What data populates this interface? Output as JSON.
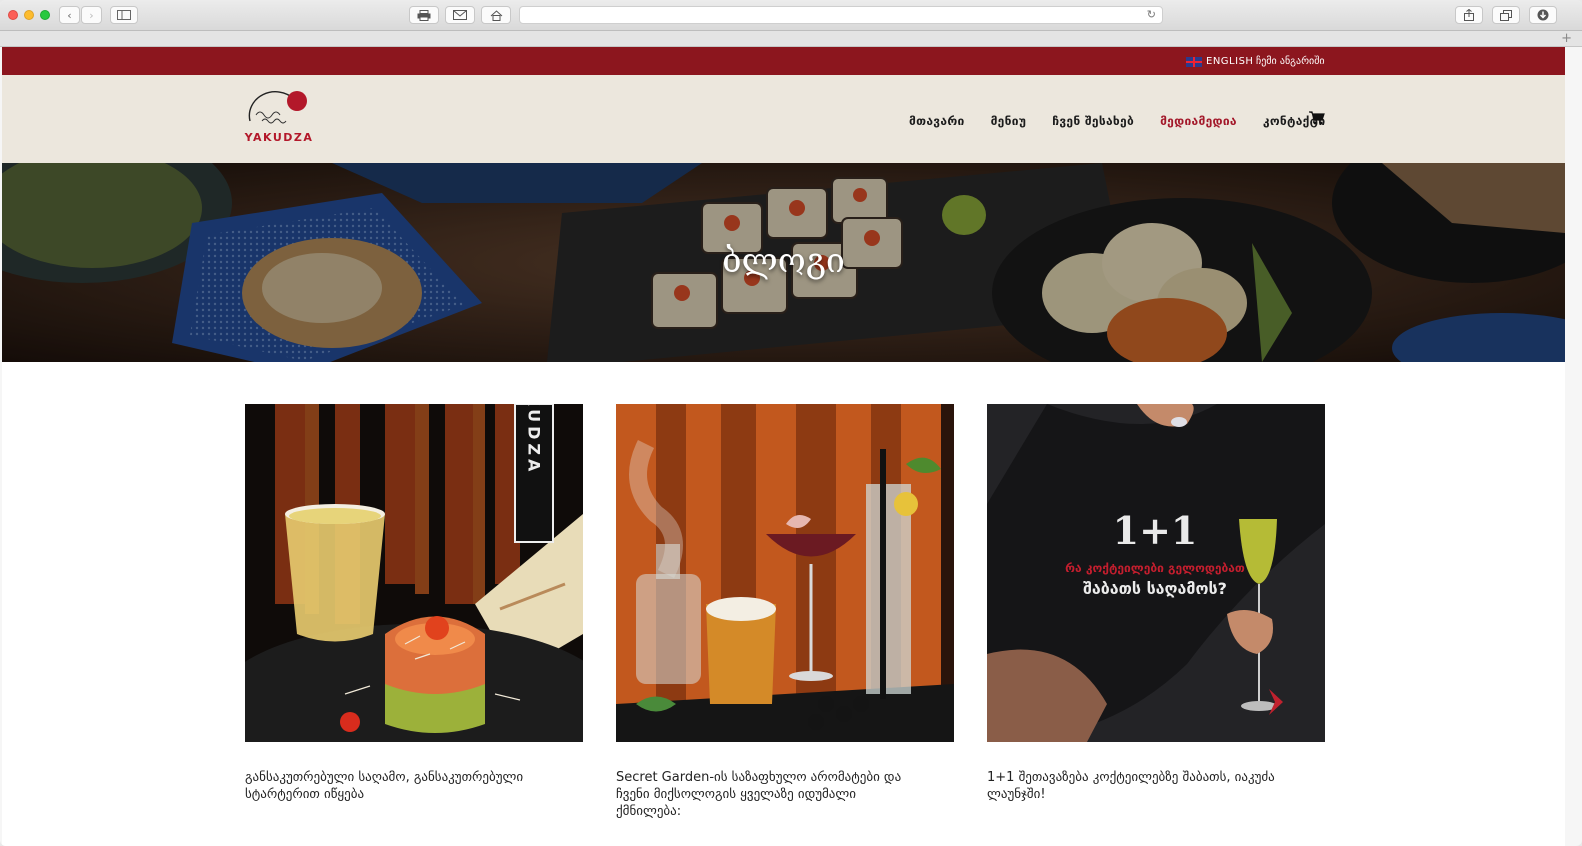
{
  "browser": {
    "icons": [
      "back-icon",
      "forward-icon",
      "sidebar-icon",
      "print-icon",
      "mail-icon",
      "home-icon",
      "reload-icon",
      "share-icon",
      "tabs-icon",
      "download-icon",
      "new-tab-icon"
    ],
    "url": ""
  },
  "topbar": {
    "language_label": "ENGLISH",
    "account_label": "ჩემი ანგარიში",
    "background": "#8c161e"
  },
  "header": {
    "logo_text": "YAKUDZA",
    "nav": [
      {
        "label": "მთავარი",
        "active": false
      },
      {
        "label": "მენიუ",
        "active": false
      },
      {
        "label": "ჩვენ შესახებ",
        "active": false
      },
      {
        "label": "მედიამედია",
        "active": true
      },
      {
        "label": "კონტაქტი",
        "active": false
      }
    ],
    "cart_icon": "cart-icon",
    "accent": "#a3182a"
  },
  "hero": {
    "title": "ბლოგი"
  },
  "posts": [
    {
      "image_label": "YAKUDZA",
      "text": "განსაკუთრებული საღამო, განსაკუთრებული სტარტერით იწყება"
    },
    {
      "text": "Secret Garden-ის საზაფხულო არომატები და ჩვენი მიქსოლოგის ყველაზე იდუმალი ქმნილება:"
    },
    {
      "image_heading": "1+1",
      "image_line1": "რა კოქტეილები გელოდებათ",
      "image_line2": "შაბათს საღამოს?",
      "text": "1+1 შეთავაზება კოქტეილებზე შაბათს, იაკუძა ლაუნჯში!"
    }
  ]
}
